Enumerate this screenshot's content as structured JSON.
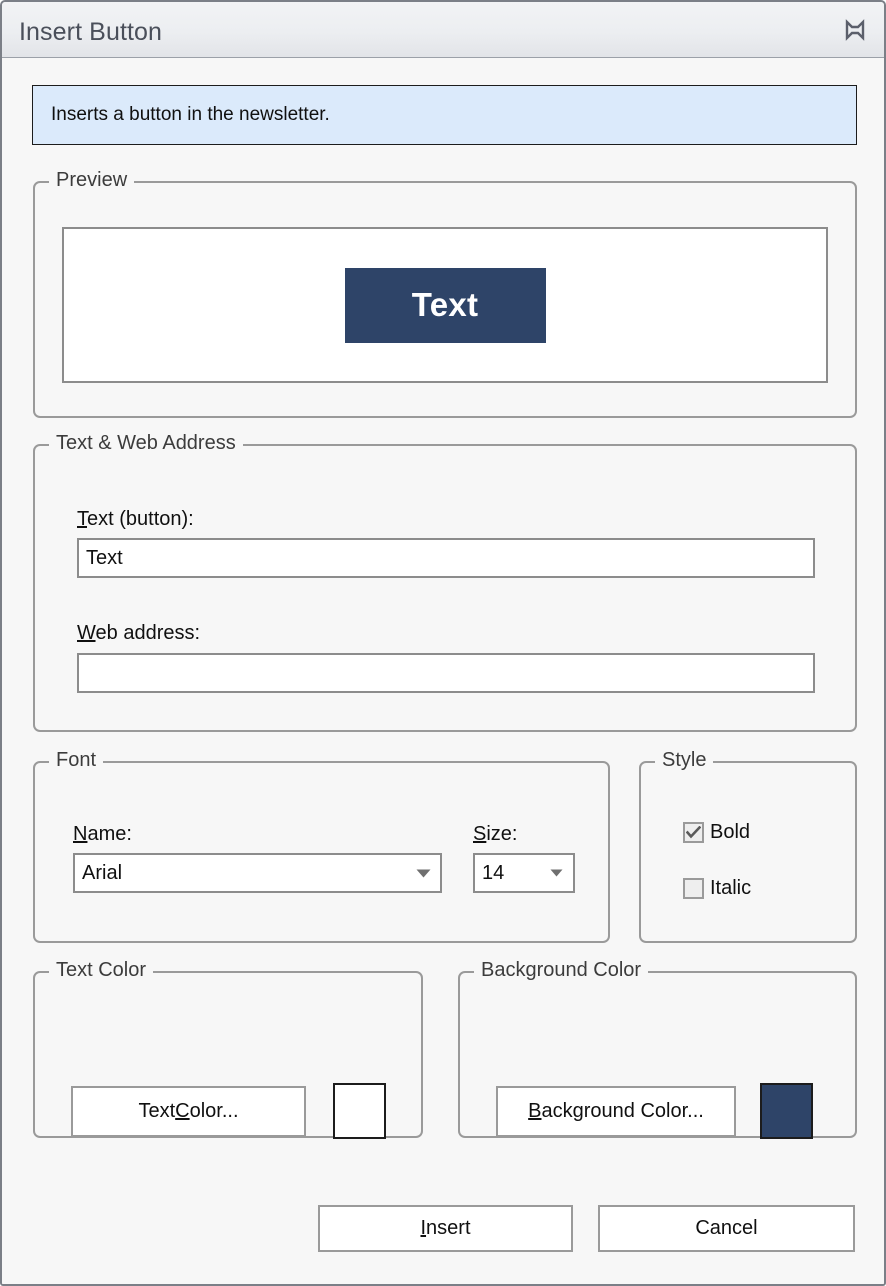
{
  "window": {
    "title": "Insert Button",
    "close_icon": "close-x-icon"
  },
  "info": {
    "message": "Inserts a button in the newsletter."
  },
  "preview": {
    "legend": "Preview",
    "button_text": "Text",
    "button_bg_color": "#2e4468",
    "button_text_color": "#ffffff",
    "canvas_bg_color": "#ffffff"
  },
  "text_web": {
    "legend": "Text & Web Address",
    "text_label_pre": "T",
    "text_label_post": "ext (button):",
    "text_value": "Text",
    "text_placeholder": "",
    "url_label_pre": "W",
    "url_label_post": "eb address:",
    "url_value": "",
    "url_placeholder": ""
  },
  "font": {
    "legend": "Font",
    "name_label_pre": "N",
    "name_label_post": "ame:",
    "name_value": "Arial",
    "size_label_pre": "S",
    "size_label_post": "ize:",
    "size_value": "14",
    "dropdown_icon": "chevron-down-icon"
  },
  "style": {
    "legend": "Style",
    "bold_label": "Bold",
    "bold_checked": "true",
    "italic_label": "Italic",
    "italic_checked": "false",
    "check_icon": "checkmark-icon"
  },
  "text_color": {
    "legend": "Text Color",
    "button_pre": "Text ",
    "button_mn": "C",
    "button_post": "olor...",
    "swatch_color": "#ffffff"
  },
  "background_color": {
    "legend": "Background Color",
    "button_mn": "B",
    "button_post": "ackground Color...",
    "swatch_color": "#2e4468"
  },
  "footer": {
    "insert_mn": "I",
    "insert_post": "nsert",
    "cancel_label": "Cancel"
  }
}
